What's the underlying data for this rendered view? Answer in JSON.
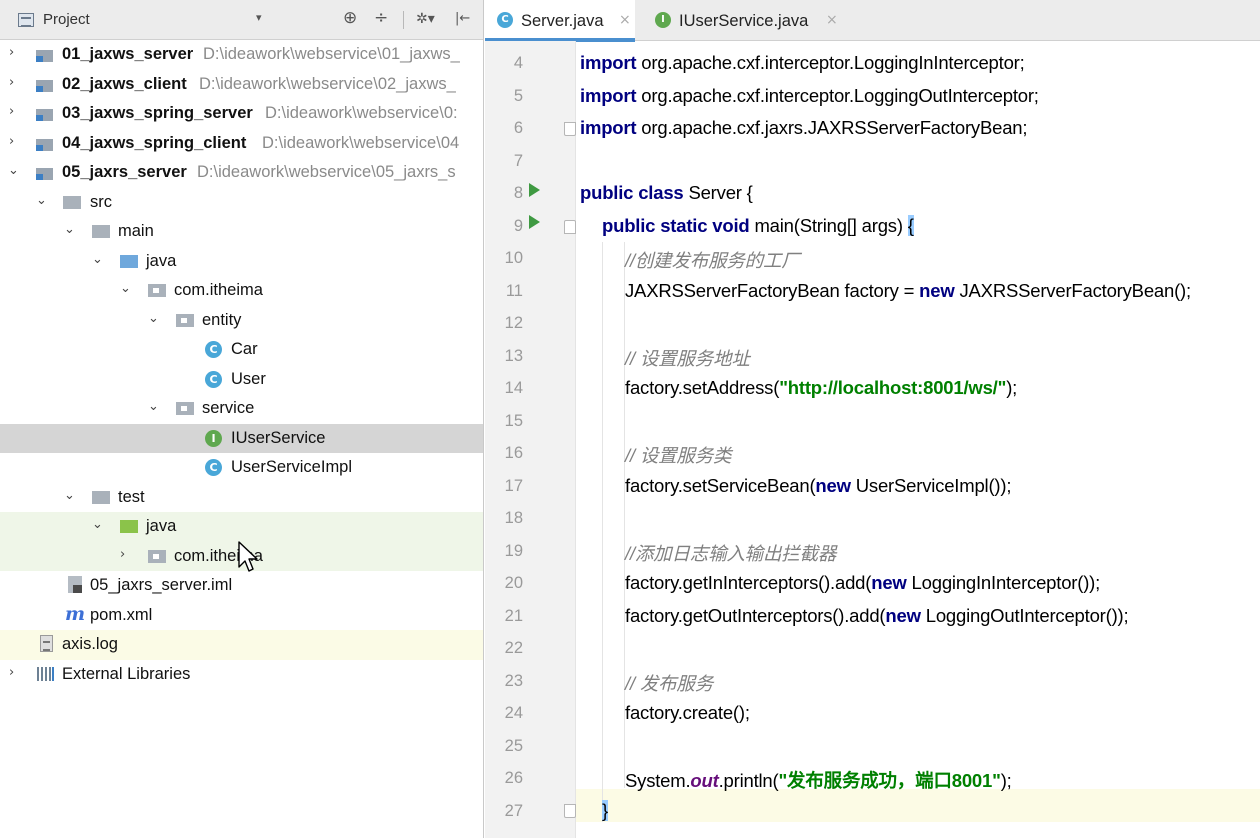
{
  "project_panel": {
    "title": "Project",
    "dropdown_glyph": "▾",
    "toolbar": {
      "locate": "⊕",
      "collapse": "÷",
      "settings": "✲▾",
      "hide": "|←"
    },
    "tree": [
      {
        "label": "01_jaxws_server",
        "path": "D:\\ideawork\\webservice\\01_jaxws_"
      },
      {
        "label": "02_jaxws_client",
        "path": "D:\\ideawork\\webservice\\02_jaxws_"
      },
      {
        "label": "03_jaxws_spring_server",
        "path": "D:\\ideawork\\webservice\\0:"
      },
      {
        "label": "04_jaxws_spring_client",
        "path": "D:\\ideawork\\webservice\\04"
      },
      {
        "label": "05_jaxrs_server",
        "path": "D:\\ideawork\\webservice\\05_jaxrs_s"
      },
      {
        "label": "src"
      },
      {
        "label": "main"
      },
      {
        "label": "java"
      },
      {
        "label": "com.itheima"
      },
      {
        "label": "entity"
      },
      {
        "label": "Car",
        "badge": "C"
      },
      {
        "label": "User",
        "badge": "C"
      },
      {
        "label": "service"
      },
      {
        "label": "IUserService",
        "badge": "I"
      },
      {
        "label": "UserServiceImpl",
        "badge": "C"
      },
      {
        "label": "test"
      },
      {
        "label": "java"
      },
      {
        "label": "com.itheima"
      },
      {
        "label": "05_jaxrs_server.iml"
      },
      {
        "label": "pom.xml",
        "badge": "m"
      },
      {
        "label": "axis.log"
      },
      {
        "label": "External Libraries"
      }
    ]
  },
  "editor": {
    "tabs": [
      {
        "label": "Server.java",
        "badge": "C",
        "close": "×",
        "color": "#49a7d8"
      },
      {
        "label": "IUserService.java",
        "badge": "I",
        "close": "×",
        "color": "#5fa84f"
      }
    ],
    "line_numbers": [
      "4",
      "5",
      "6",
      "7",
      "8",
      "9",
      "10",
      "11",
      "12",
      "13",
      "14",
      "15",
      "16",
      "17",
      "18",
      "19",
      "20",
      "21",
      "22",
      "23",
      "24",
      "25",
      "26",
      "27"
    ],
    "code": {
      "l4": {
        "kw": "import",
        "rest": " org.apache.cxf.interceptor.LoggingInInterceptor;"
      },
      "l5": {
        "kw": "import",
        "rest": " org.apache.cxf.interceptor.LoggingOutInterceptor;"
      },
      "l6": {
        "kw": "import",
        "rest": " org.apache.cxf.jaxrs.JAXRSServerFactoryBean;"
      },
      "l8": {
        "kw": "public class",
        "rest": " Server {"
      },
      "l9": {
        "kw": "public static void",
        "rest": " main(String[] args) ",
        "brace": "{"
      },
      "l10": {
        "comment": "//创建发布服务的工厂"
      },
      "l11": {
        "pre": "JAXRSServerFactoryBean factory = ",
        "kw": "new",
        "post": " JAXRSServerFactoryBean();"
      },
      "l13": {
        "comment": "// 设置服务地址"
      },
      "l14": {
        "pre": "factory.setAddress(",
        "str": "\"http://localhost:8001/ws/\"",
        "post": ");"
      },
      "l16": {
        "comment": "// 设置服务类"
      },
      "l17": {
        "pre": "factory.setServiceBean(",
        "kw": "new",
        "post": " UserServiceImpl());"
      },
      "l19": {
        "comment": "//添加日志输入输出拦截器"
      },
      "l20": {
        "pre": "factory.getInInterceptors().add(",
        "kw": "new",
        "post": " LoggingInInterceptor());"
      },
      "l21": {
        "pre": "factory.getOutInterceptors().add(",
        "kw": "new",
        "post": " LoggingOutInterceptor());"
      },
      "l23": {
        "comment": "// 发布服务"
      },
      "l24": {
        "pre": "factory.create();"
      },
      "l26": {
        "pre": "System.",
        "field": "out",
        "mid": ".println(",
        "str": "\"发布服务成功，端口8001\"",
        "post": ");"
      },
      "l27": {
        "brace": "}"
      }
    }
  },
  "colors": {
    "keyword": "#000080",
    "string": "#008000",
    "comment": "#808080",
    "static_field": "#660e7a",
    "run_icon": "#3f9a42",
    "selection": "#d5d5d5",
    "active_tab_underline": "#4a8fcf"
  }
}
